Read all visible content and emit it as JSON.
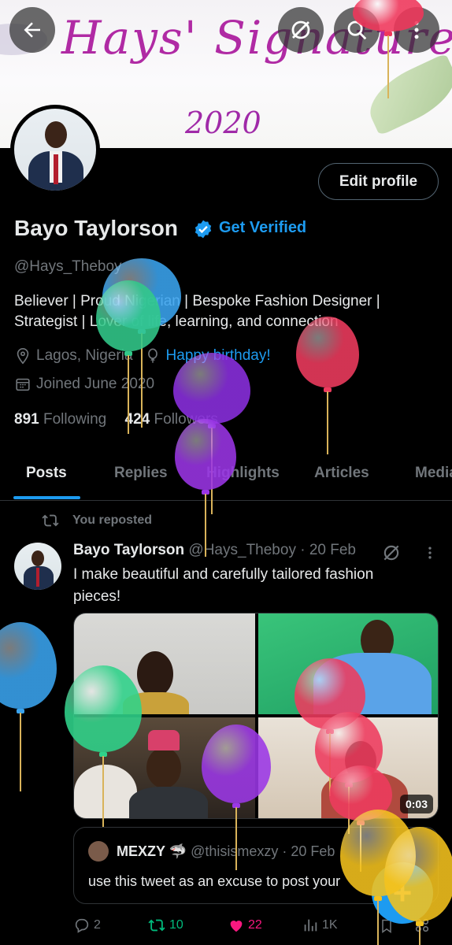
{
  "banner": {
    "title": "Hays' Signature",
    "year": "2020"
  },
  "header_buttons": {
    "back_icon": "arrow-left-icon",
    "grok_icon": "grok-icon",
    "search_icon": "search-icon",
    "more_icon": "more-vertical-icon"
  },
  "profile": {
    "edit_label": "Edit profile",
    "name": "Bayo Taylorson",
    "get_verified": "Get Verified",
    "handle": "@Hays_Theboy",
    "bio_line1": "Believer | Proud Nigerian | Bespoke Fashion Designer |",
    "bio_line2": "Strategist | Lover of life, learning, and connection",
    "location": "Lagos, Nigeria",
    "birthday": "Happy birthday!",
    "joined": "Joined June 2020",
    "following_count": "891",
    "following_label": "Following",
    "followers_count": "424",
    "followers_label": "Followers"
  },
  "tabs": [
    {
      "label": "Posts"
    },
    {
      "label": "Replies"
    },
    {
      "label": "Highlights"
    },
    {
      "label": "Articles"
    },
    {
      "label": "Media"
    }
  ],
  "post": {
    "repost_label": "You reposted",
    "author_name": "Bayo Taylorson",
    "author_meta": "@Hays_Theboy · 20 Feb",
    "text_line1": "I make beautiful and carefully tailored fashion",
    "text_line2": "pieces!",
    "video_duration": "0:03",
    "quote": {
      "name": "MEXZY 🦈",
      "meta": "@thisismexzy · 20 Feb",
      "text": "use this tweet as an excuse to post your"
    },
    "actions": {
      "replies": "2",
      "reposts": "10",
      "likes": "22",
      "views": "1K"
    }
  },
  "fab_label": "+",
  "colors": {
    "accent": "#1d9bf0",
    "repost_green": "#00ba7c",
    "like_pink": "#f91880",
    "banner_text": "#b02aa4"
  }
}
